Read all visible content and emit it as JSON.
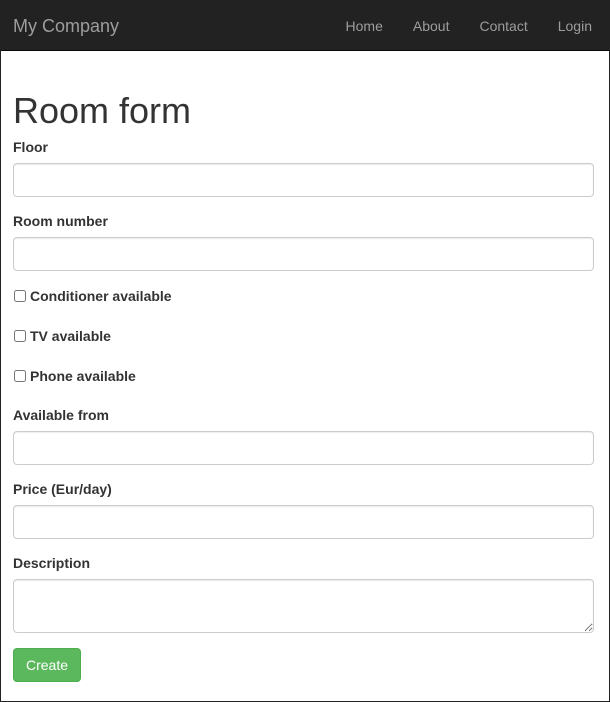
{
  "navbar": {
    "brand": "My Company",
    "links": [
      "Home",
      "About",
      "Contact",
      "Login"
    ]
  },
  "form": {
    "title": "Room form",
    "floor_label": "Floor",
    "floor_value": "",
    "room_number_label": "Room number",
    "room_number_value": "",
    "conditioner_label": "Conditioner available",
    "tv_label": "TV available",
    "phone_label": "Phone available",
    "available_from_label": "Available from",
    "available_from_value": "",
    "price_label": "Price (Eur/day)",
    "price_value": "",
    "description_label": "Description",
    "description_value": "",
    "submit_label": "Create"
  },
  "colors": {
    "navbar_bg": "#222222",
    "nav_text": "#9d9d9d",
    "button_bg": "#5cb85c"
  }
}
